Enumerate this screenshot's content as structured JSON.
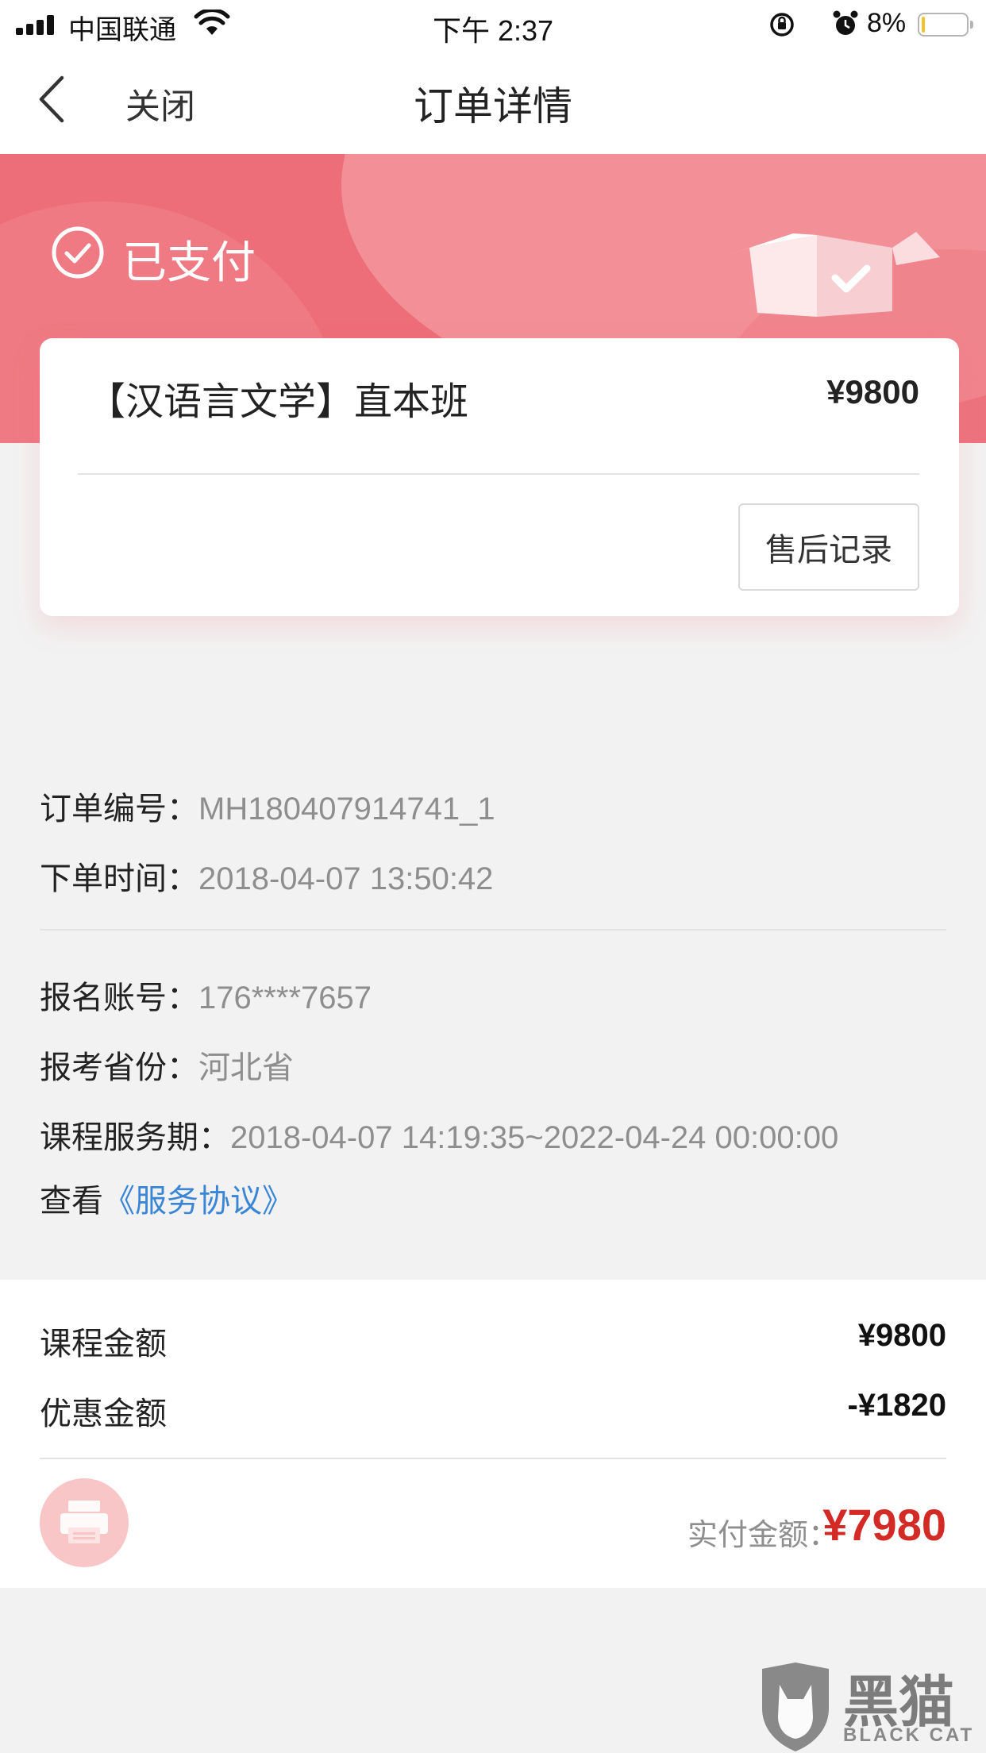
{
  "status_bar": {
    "carrier": "中国联通",
    "time": "下午 2:37",
    "battery_percent": "8%",
    "battery_level": 0.08,
    "battery_color": "#f4c22b"
  },
  "nav": {
    "back_icon": "chevron-left-icon",
    "close_label": "关闭",
    "title": "订单详情"
  },
  "banner": {
    "status_icon": "check-circle-icon",
    "status_text": "已支付",
    "illustration": "open-box-check-icon",
    "color": "#ed6d78"
  },
  "order_card": {
    "course_name": "【汉语言文学】直本班",
    "price": "¥9800",
    "aftersale_button": "售后记录"
  },
  "order_info": {
    "order_no_label": "订单编号：",
    "order_no": "MH180407914741_1",
    "order_time_label": "下单时间：",
    "order_time": "2018-04-07 13:50:42"
  },
  "enroll_info": {
    "account_label": "报名账号：",
    "account": "176****7657",
    "province_label": "报考省份：",
    "province": "河北省",
    "service_period_label": "课程服务期：",
    "service_period": "2018-04-07 14:19:35~2022-04-24 00:00:00",
    "agreement_prefix": "查看",
    "agreement_link": "《服务协议》"
  },
  "amounts": {
    "course_amount_label": "课程金额",
    "course_amount": "¥9800",
    "discount_label": "优惠金额",
    "discount": "-¥1820",
    "paid_label": "实付金额：",
    "paid": "¥7980",
    "paid_color": "#d42a25",
    "print_icon": "printer-icon"
  },
  "watermark": {
    "cn": "黑猫",
    "en": "BLACK CAT"
  }
}
